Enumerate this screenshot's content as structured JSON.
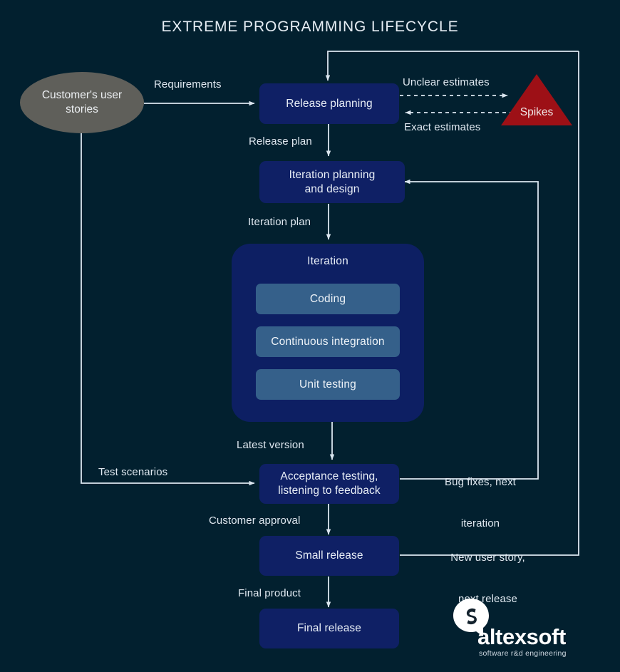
{
  "title": "EXTREME PROGRAMMING LIFECYCLE",
  "colors": {
    "background": "#02202f",
    "box": "#0f2065",
    "iteration_container": "#0d1f63",
    "sub_box": "#35608a",
    "ellipse": "#5f5f5a",
    "spikes": "#9d1016",
    "edge": "#dbe6f0",
    "text": "#e8eef6"
  },
  "chart_data": {
    "type": "diagram",
    "title": "EXTREME PROGRAMMING LIFECYCLE",
    "nodes": [
      {
        "id": "customer_stories",
        "label": "Customer's user\nstories",
        "shape": "ellipse"
      },
      {
        "id": "release_planning",
        "label": "Release planning",
        "shape": "rounded-rect"
      },
      {
        "id": "spikes",
        "label": "Spikes",
        "shape": "triangle"
      },
      {
        "id": "iteration_planning",
        "label": "Iteration planning\nand design",
        "shape": "rounded-rect"
      },
      {
        "id": "iteration",
        "label": "Iteration",
        "shape": "rounded-container"
      },
      {
        "id": "coding",
        "label": "Coding",
        "shape": "rounded-rect"
      },
      {
        "id": "continuous_integration",
        "label": "Continuous integration",
        "shape": "rounded-rect"
      },
      {
        "id": "unit_testing",
        "label": "Unit testing",
        "shape": "rounded-rect"
      },
      {
        "id": "acceptance_testing",
        "label": "Acceptance testing,\nlistening to feedback",
        "shape": "rounded-rect"
      },
      {
        "id": "small_release",
        "label": "Small release",
        "shape": "rounded-rect"
      },
      {
        "id": "final_release",
        "label": "Final release",
        "shape": "rounded-rect"
      }
    ],
    "edges": [
      {
        "from": "customer_stories",
        "to": "release_planning",
        "label": "Requirements",
        "style": "solid"
      },
      {
        "from": "release_planning",
        "to": "spikes",
        "label": "Unclear estimates",
        "style": "dashed"
      },
      {
        "from": "spikes",
        "to": "release_planning",
        "label": "Exact estimates",
        "style": "dashed"
      },
      {
        "from": "release_planning",
        "to": "iteration_planning",
        "label": "Release plan",
        "style": "solid"
      },
      {
        "from": "iteration_planning",
        "to": "iteration",
        "label": "Iteration plan",
        "style": "solid"
      },
      {
        "from": "iteration",
        "to": "acceptance_testing",
        "label": "Latest version",
        "style": "solid"
      },
      {
        "from": "customer_stories",
        "to": "acceptance_testing",
        "label": "Test scenarios",
        "style": "solid"
      },
      {
        "from": "acceptance_testing",
        "to": "iteration_planning",
        "label": "Bug fixes, next\niteration",
        "style": "solid"
      },
      {
        "from": "acceptance_testing",
        "to": "small_release",
        "label": "Customer approval",
        "style": "solid"
      },
      {
        "from": "small_release",
        "to": "release_planning",
        "label": "New user story,\nnext release",
        "style": "solid"
      },
      {
        "from": "small_release",
        "to": "final_release",
        "label": "Final product",
        "style": "solid"
      }
    ]
  },
  "nodes": {
    "customer_stories": {
      "line1": "Customer's user",
      "line2": "stories"
    },
    "release_planning": {
      "label": "Release planning"
    },
    "spikes": {
      "label": "Spikes"
    },
    "iteration_planning": {
      "line1": "Iteration planning",
      "line2": "and design"
    },
    "iteration": {
      "label": "Iteration"
    },
    "coding": {
      "label": "Coding"
    },
    "continuous_integration": {
      "label": "Continuous integration"
    },
    "unit_testing": {
      "label": "Unit testing"
    },
    "acceptance_testing": {
      "line1": "Acceptance testing,",
      "line2": "listening to feedback"
    },
    "small_release": {
      "label": "Small release"
    },
    "final_release": {
      "label": "Final release"
    }
  },
  "edge_labels": {
    "requirements": "Requirements",
    "unclear_estimates": "Unclear estimates",
    "exact_estimates": "Exact estimates",
    "release_plan": "Release plan",
    "iteration_plan": "Iteration plan",
    "latest_version": "Latest version",
    "test_scenarios": "Test scenarios",
    "bug_fixes_line1": "Bug fixes, next",
    "bug_fixes_line2": "iteration",
    "customer_approval": "Customer approval",
    "new_user_story_line1": "New user story,",
    "new_user_story_line2": "next release",
    "final_product": "Final product"
  },
  "logo": {
    "word": "altexsoft",
    "tagline": "software r&d engineering"
  }
}
